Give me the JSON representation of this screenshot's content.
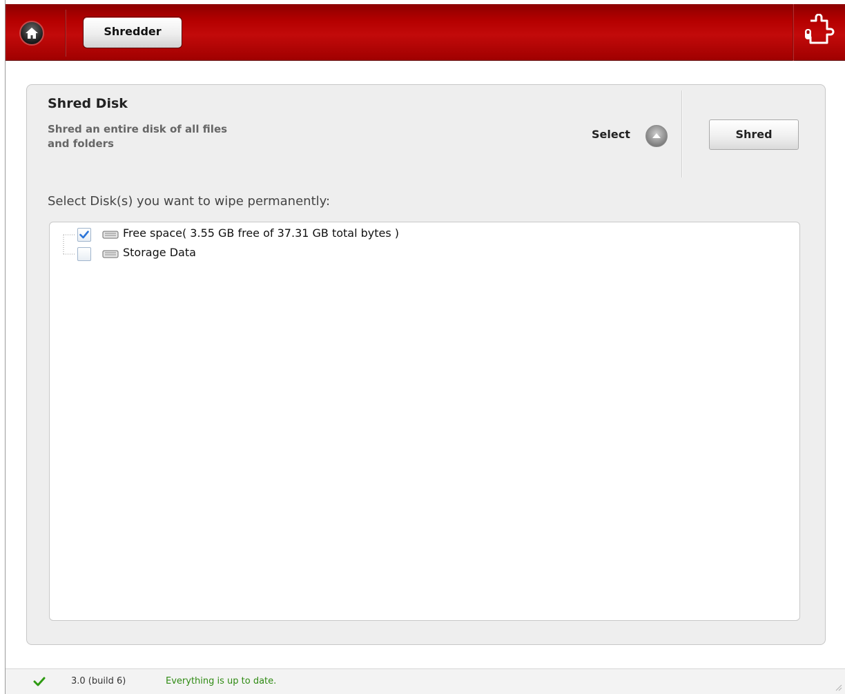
{
  "header": {
    "home_icon": "home-icon",
    "breadcrumb_label": "Shredder",
    "plugin_icon": "puzzle-plugin-icon",
    "brand_color": "#b50000"
  },
  "panel": {
    "title": "Shred Disk",
    "description": "Shred an entire disk of all files and folders",
    "select_label": "Select",
    "select_icon": "chevron-up-icon",
    "shred_button_label": "Shred"
  },
  "disk_list": {
    "prompt": "Select Disk(s) you want to wipe permanently:",
    "items": [
      {
        "label": "Free space( 3.55 GB free of 37.31 GB total bytes )",
        "checked": true,
        "icon": "drive-icon"
      },
      {
        "label": "Storage Data",
        "checked": false,
        "icon": "drive-icon"
      }
    ]
  },
  "status_bar": {
    "status_icon": "check-icon",
    "version": "3.0 (build 6)",
    "message": "Everything is up to date.",
    "message_color": "#2e8a12"
  }
}
